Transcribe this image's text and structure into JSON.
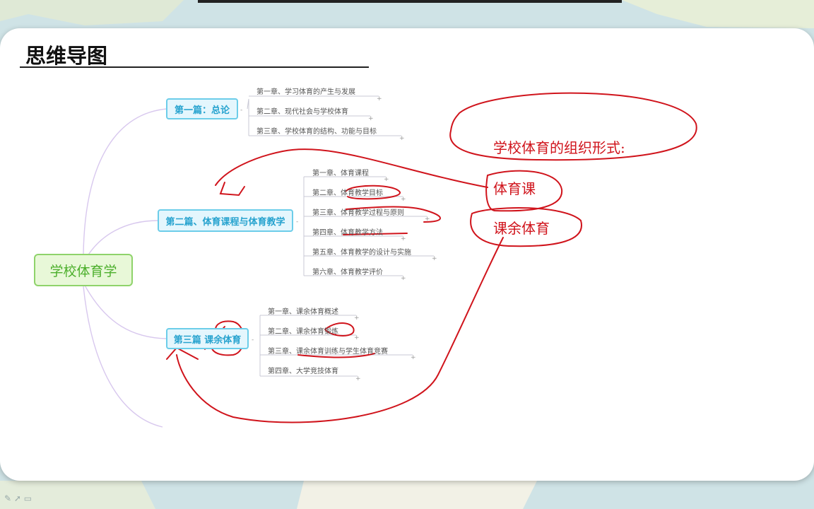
{
  "header": {
    "title": "思维导图"
  },
  "mindmap": {
    "root": "学校体育学",
    "sections": [
      {
        "label": "第一篇：总论",
        "chapters": [
          "第一章、学习体育的产生与发展",
          "第二章、现代社会与学校体育",
          "第三章、学校体育的结构、功能与目标"
        ]
      },
      {
        "label": "第二篇、体育课程与体育教学",
        "chapters": [
          "第一章、体育课程",
          "第二章、体育教学目标",
          "第三章、体育教学过程与原则",
          "第四章、体育教学方法",
          "第五章、体育教学的设计与实施",
          "第六章、体育教学评价"
        ]
      },
      {
        "label": "第三篇 课余体育",
        "chapters": [
          "第一章、课余体育概述",
          "第二章、课余体育锻炼",
          "第三章、课余体育训练与学生体育竞赛",
          "第四章、大学竞技体育"
        ]
      }
    ]
  },
  "annotations": {
    "heading": "学校体育的组织形式:",
    "item1": "体育课",
    "item2": "课余体育"
  },
  "colors": {
    "ink": "#d0141c",
    "section_text": "#27a3cf",
    "root_text": "#4caf2c"
  }
}
